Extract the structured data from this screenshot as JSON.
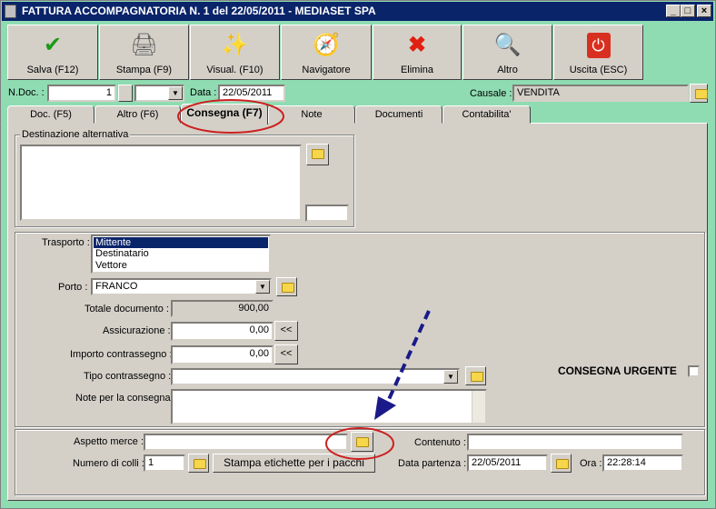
{
  "window": {
    "title": "FATTURA ACCOMPAGNATORIA N. 1  del 22/05/2011 - MEDIASET SPA",
    "min": "_",
    "max": "□",
    "close": "×"
  },
  "toolbar": [
    {
      "label": "Salva (F12)",
      "icon": "✔"
    },
    {
      "label": "Stampa (F9)",
      "icon": "🖨"
    },
    {
      "label": "Visual. (F10)",
      "icon": "✨"
    },
    {
      "label": "Navigatore",
      "icon": "🧭"
    },
    {
      "label": "Elimina",
      "icon": "✖"
    },
    {
      "label": "Altro",
      "icon": "🔍"
    },
    {
      "label": "Uscita (ESC)",
      "icon": "⏻"
    }
  ],
  "header": {
    "ndoc_label": "N.Doc. :",
    "ndoc_value": "1",
    "data_label": "Data :",
    "data_value": "22/05/2011",
    "causale_label": "Causale :",
    "causale_value": "VENDITA"
  },
  "tabs": [
    "Doc. (F5)",
    "Altro (F6)",
    "Consegna (F7)",
    "Note",
    "Documenti",
    "Contabilita'"
  ],
  "destinazione": {
    "label": "Destinazione alternativa"
  },
  "form": {
    "trasporto_label": "Trasporto :",
    "trasporto_options": [
      "Mittente",
      "Destinatario",
      "Vettore"
    ],
    "porto_label": "Porto :",
    "porto_value": "FRANCO",
    "totale_label": "Totale documento :",
    "totale_value": "900,00",
    "assicurazione_label": "Assicurazione :",
    "assicurazione_value": "0,00",
    "contrassegno_label": "Importo contrassegno :",
    "contrassegno_value": "0,00",
    "back_btn": "<<",
    "tipo_label": "Tipo contrassegno :",
    "note_label": "Note per la consegna",
    "urgente_label": "CONSEGNA URGENTE"
  },
  "bottom": {
    "aspetto_label": "Aspetto merce :",
    "contenuto_label": "Contenuto :",
    "colli_label": "Numero di colli :",
    "colli_value": "1",
    "stampa_btn": "Stampa etichette per i pacchi",
    "partenza_label": "Data partenza :",
    "partenza_value": "22/05/2011",
    "ora_label": "Ora :",
    "ora_value": "22:28:14"
  }
}
